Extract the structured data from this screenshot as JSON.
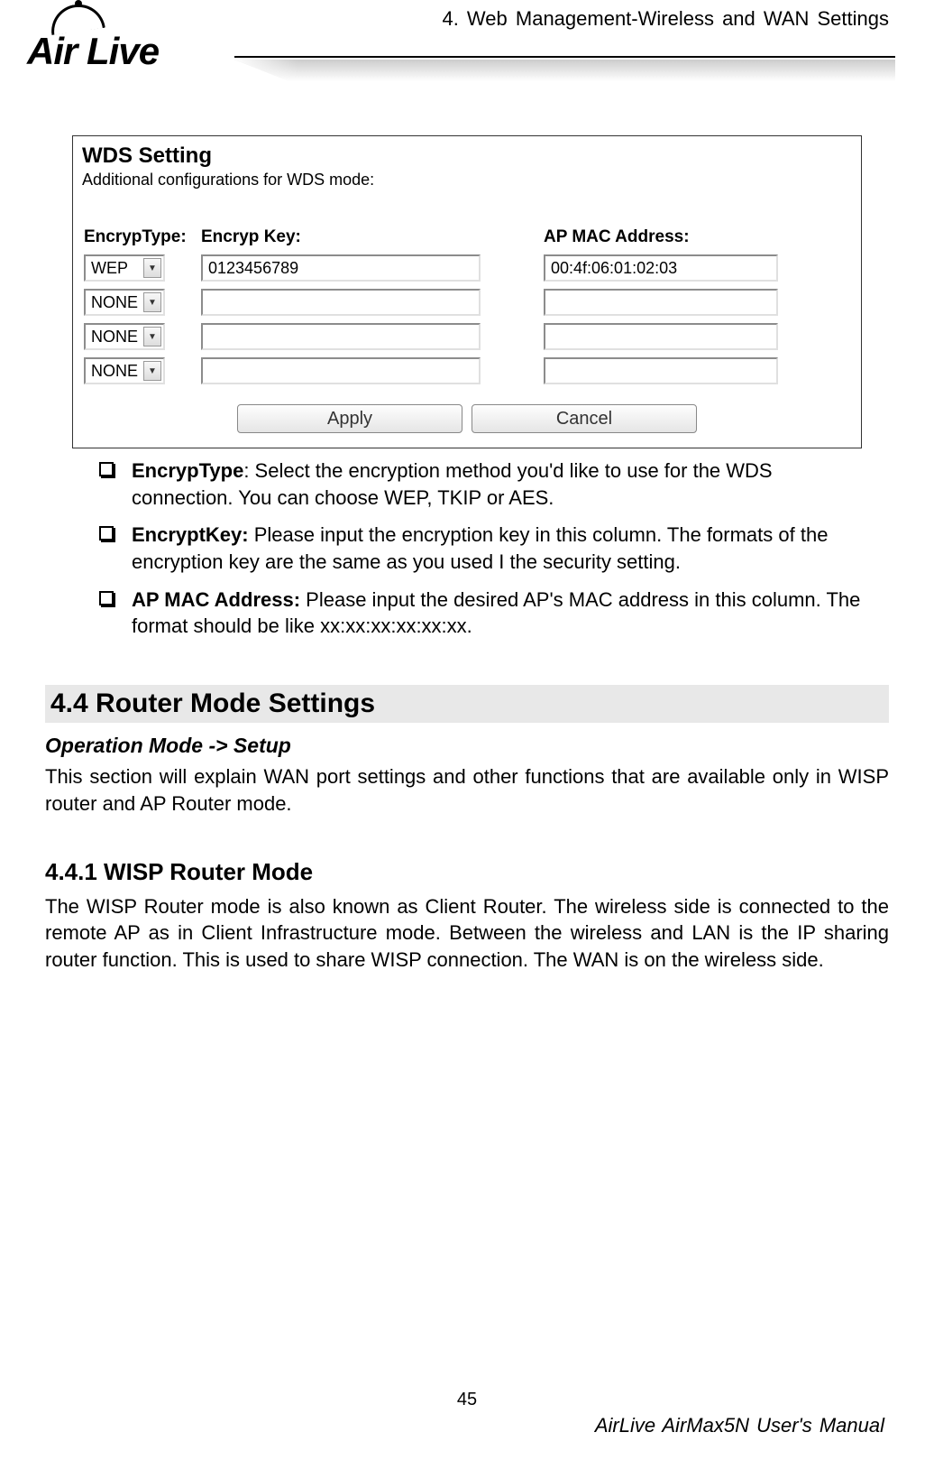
{
  "header": {
    "logo_text": "Air Live",
    "chapter": "4. Web Management-Wireless and WAN Settings"
  },
  "wds": {
    "title": "WDS Setting",
    "subtitle": "Additional configurations for WDS mode:",
    "headers": {
      "c1": "EncrypType:",
      "c2": "Encryp Key:",
      "c3": "AP MAC Address:"
    },
    "rows": [
      {
        "type": "WEP",
        "key": "0123456789",
        "mac": "00:4f:06:01:02:03"
      },
      {
        "type": "NONE",
        "key": "",
        "mac": ""
      },
      {
        "type": "NONE",
        "key": "",
        "mac": ""
      },
      {
        "type": "NONE",
        "key": "",
        "mac": ""
      }
    ],
    "apply": "Apply",
    "cancel": "Cancel"
  },
  "bullets": [
    {
      "term": "EncrypType",
      "sep": ": ",
      "text": "Select the encryption method you'd like to use for the WDS connection. You can choose WEP, TKIP or AES."
    },
    {
      "term": "EncryptKey:",
      "sep": " ",
      "text": "Please input the encryption key in this column. The formats of the encryption key are the same as you used I the security setting."
    },
    {
      "term": "AP MAC Address:",
      "sep": " ",
      "text": "Please input the desired AP's MAC address in this column. The format should be like xx:xx:xx:xx:xx:xx."
    }
  ],
  "section": {
    "heading": "4.4 Router  Mode  Settings",
    "subhead": "Operation Mode -> Setup",
    "intro": "This section will explain WAN port settings and other functions that are available only in WISP router and AP Router mode."
  },
  "subsection": {
    "heading": "4.4.1  WISP Router Mode",
    "body": "The WISP Router mode is also known as Client Router. The wireless side is connected to the remote AP as in Client Infrastructure mode. Between the wireless and LAN is the IP sharing router function. This is used to share WISP connection. The WAN is on the wireless side."
  },
  "footer": {
    "page": "45",
    "manual": "AirLive AirMax5N User's Manual"
  }
}
